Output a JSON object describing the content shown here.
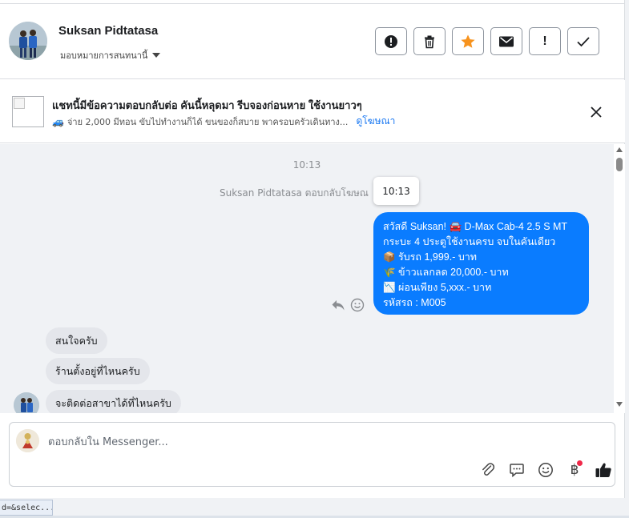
{
  "header": {
    "name": "Suksan Pidtatasa",
    "assign_label": "มอบหมายการสนทนานี้",
    "actions": [
      {
        "icon": "alert-circle-icon",
        "label": ""
      },
      {
        "icon": "trash-icon",
        "label": ""
      },
      {
        "icon": "star-icon",
        "label": "",
        "color": "#f7931e"
      },
      {
        "icon": "envelope-icon",
        "label": ""
      },
      {
        "icon": "exclamation-icon",
        "label": "!"
      },
      {
        "icon": "check-icon",
        "label": ""
      }
    ]
  },
  "banner": {
    "title": "แชทนี้มีข้อความตอบกลับต่อ คันนี้หลุดมา รีบจองก่อนหาย ใช้งานยาวๆ",
    "subtitle": "จ่าย 2,000 มีทอน ขับไปทำงานก็ได้ ขนของก็สบาย พาครอบครัวเดินทาง...",
    "link": "ดูโฆษณา"
  },
  "chat": {
    "timestamp": "10:13",
    "reply_note": "Suksan Pidtatasa ตอบกลับโฆษณ",
    "tooltip": "10:13",
    "outgoing_lines": [
      "สวัสดี Suksan! 🚘 D-Max Cab-4 2.5 S MT",
      "กระบะ 4 ประตูใช้งานครบ จบในคันเดียว",
      "📦 รับรถ 1,999.- บาท",
      "🌾 ข้าวแลกลด 20,000.- บาท",
      "📉 ผ่อนเพียง 5,xxx.- บาท",
      "รหัสรถ : M005"
    ],
    "incoming": [
      "สนใจครับ",
      "ร้านตั้งอยู่ที่ไหนครับ",
      "จะติดต่อสาขาได้ที่ไหนครับ"
    ],
    "accent_color": "#0a7cff"
  },
  "composer": {
    "placeholder": "ตอบกลับใน Messenger..."
  },
  "statusbar": {
    "text": "d=&selec..."
  }
}
